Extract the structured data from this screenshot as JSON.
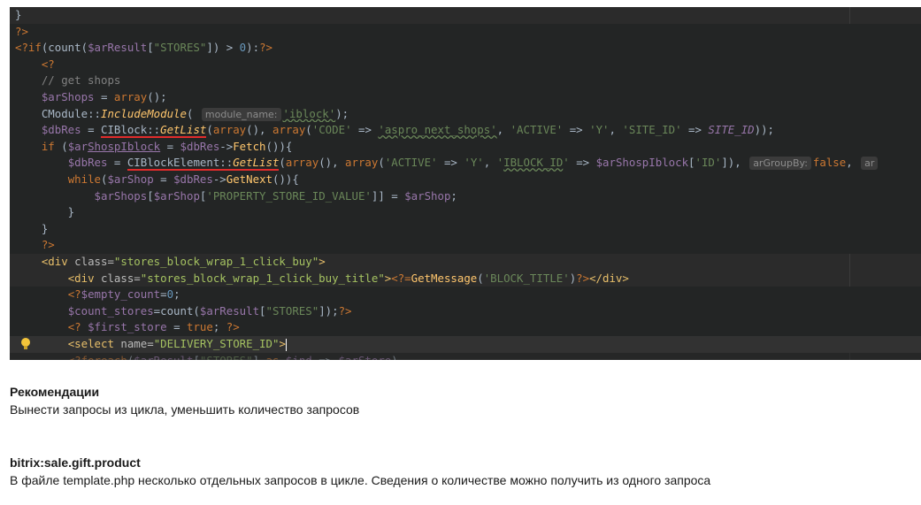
{
  "code_lines": [
    "}",
    "?>",
    "<?if(count($arResult[\"STORES\"]) > 0):?>",
    "    <?",
    "    // get shops",
    "    $arShops = array();",
    "    CModule::IncludeModule( module_name: 'iblock');",
    "    $dbRes = CIBlock::GetList(array(), array('CODE' => 'aspro_next_shops', 'ACTIVE' => 'Y', 'SITE_ID' => SITE_ID));",
    "    if ($arShospIblock = $dbRes->Fetch()){",
    "        $dbRes = CIBlockElement::GetList(array(), array('ACTIVE' => 'Y', 'IBLOCK_ID' => $arShospIblock['ID']),  arGroupBy: false,",
    "        while($arShop = $dbRes->GetNext()){",
    "            $arShops[$arShop['PROPERTY_STORE_ID_VALUE']] = $arShop;",
    "        }",
    "    }",
    "    ?>",
    "    <div class=\"stores_block_wrap_1_click_buy\">",
    "        <div class=\"stores_block_wrap_1_click_buy_title\"><?=GetMessage('BLOCK_TITLE')?></div>",
    "        <?$empty_count=0;",
    "        $count_stores=count($arResult[\"STORES\"]);?>",
    "        <? $first_store = true; ?>",
    "        <select name=\"DELIVERY_STORE_ID\">"
  ],
  "inlay_hints": {
    "module_name": "module_name:",
    "ar_group_by": "arGroupBy:",
    "cut_hint": "ar"
  },
  "notes": [
    {
      "title": "Рекомендации",
      "text": "Вынести запросы из цикла, уменьшить количество запросов"
    },
    {
      "title": "bitrix:sale.gift.product",
      "text": "В файле template.php несколько отдельных запросов в цикле. Сведения о количестве можно получить из одного запроса"
    }
  ]
}
